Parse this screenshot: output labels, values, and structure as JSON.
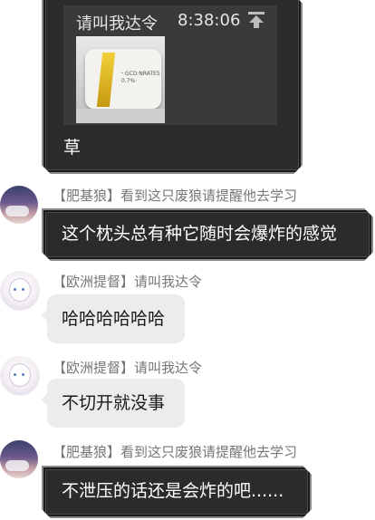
{
  "messages": [
    {
      "quoted_header_name": "请叫我达令",
      "quoted_header_time": "8:38:06",
      "quoted_image_lines": [
        "・GCD·NRATES",
        "0.7%·"
      ],
      "text": "草"
    },
    {
      "sender": "【肥基狼】看到这只废狼请提醒他去学习",
      "text": "这个枕头总有种它随时会爆炸的感觉"
    },
    {
      "sender": "【欧洲提督】请叫我达令",
      "text": "哈哈哈哈哈哈"
    },
    {
      "sender": "【欧洲提督】请叫我达令",
      "text": "不切开就没事"
    },
    {
      "sender": "【肥基狼】看到这只废狼请提醒他去学习",
      "text": "不泄压的话还是会炸的吧......"
    }
  ],
  "colors": {
    "dark_bubble": "#2b2b2b",
    "gray_bubble": "#ececec",
    "sender_text": "#777777"
  }
}
